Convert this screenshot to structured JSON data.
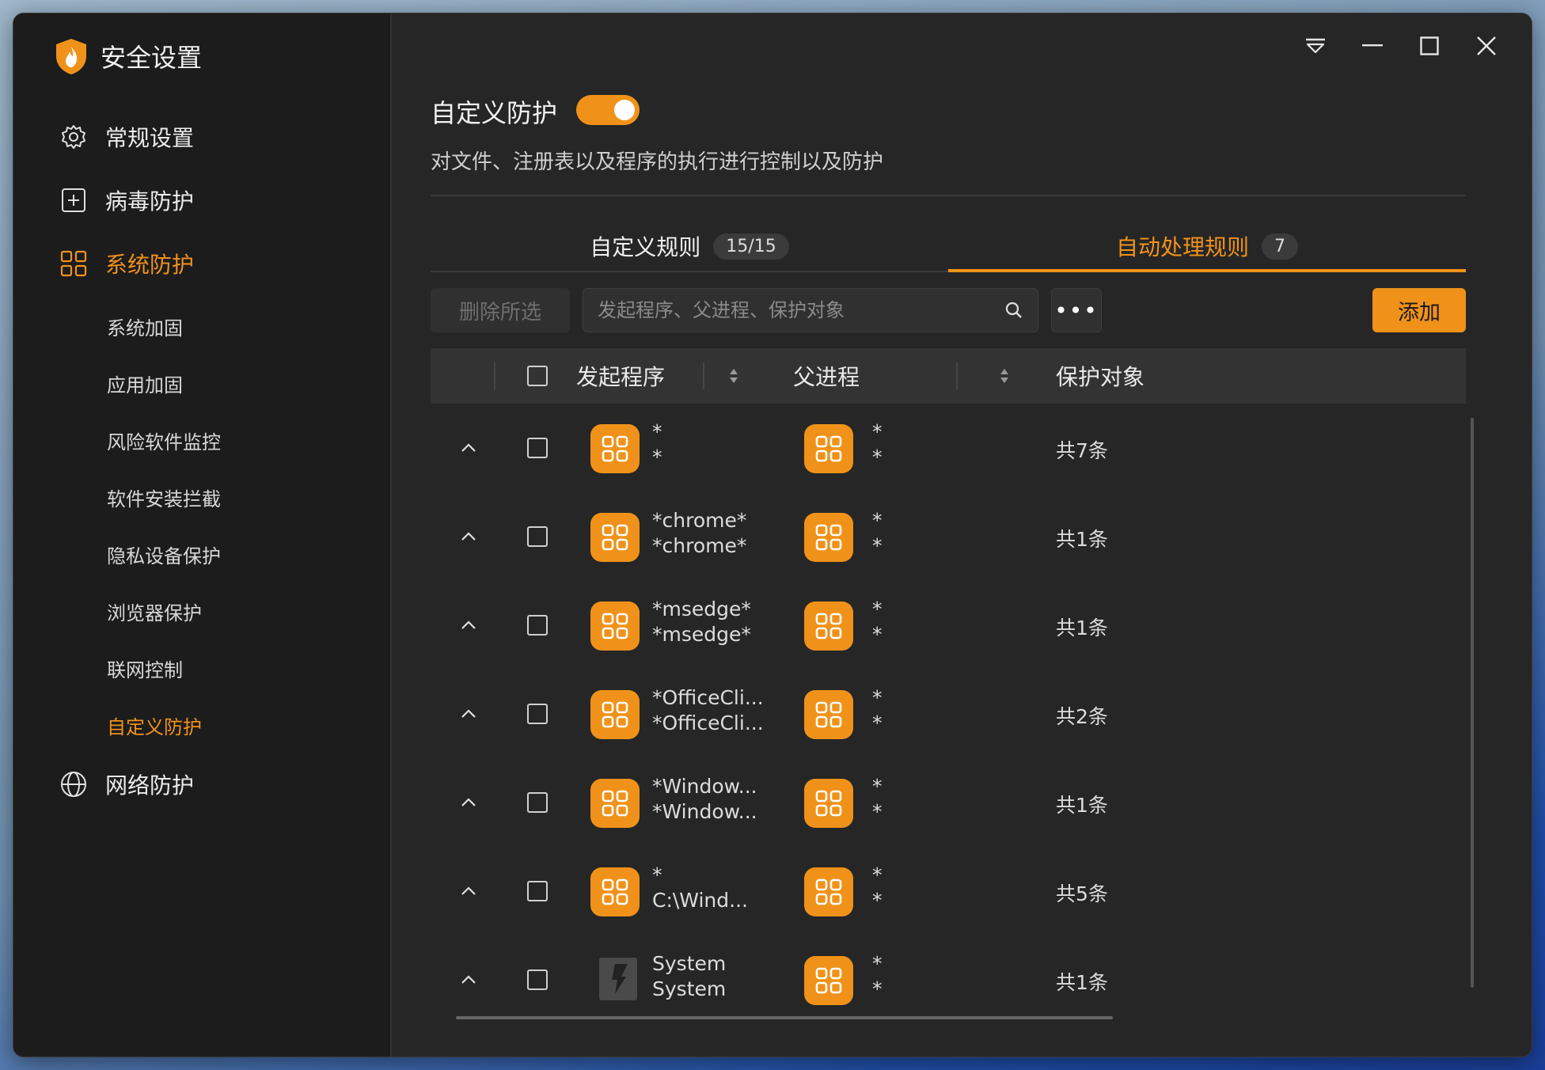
{
  "app": {
    "title": "安全设置"
  },
  "window_controls": [
    "menu",
    "minimize",
    "maximize",
    "close"
  ],
  "sidebar": {
    "main_items": [
      {
        "label": "常规设置",
        "icon": "gear-icon",
        "active": false
      },
      {
        "label": "病毒防护",
        "icon": "plus-box-icon",
        "active": false
      },
      {
        "label": "系统防护",
        "icon": "grid-icon",
        "active": true
      },
      {
        "label": "网络防护",
        "icon": "globe-icon",
        "active": false
      }
    ],
    "sub_items": [
      {
        "label": "系统加固",
        "active": false
      },
      {
        "label": "应用加固",
        "active": false
      },
      {
        "label": "风险软件监控",
        "active": false
      },
      {
        "label": "软件安装拦截",
        "active": false
      },
      {
        "label": "隐私设备保护",
        "active": false
      },
      {
        "label": "浏览器保护",
        "active": false
      },
      {
        "label": "联网控制",
        "active": false
      },
      {
        "label": "自定义防护",
        "active": true
      }
    ]
  },
  "header": {
    "title": "自定义防护",
    "toggle_on": true,
    "description": "对文件、注册表以及程序的执行进行控制以及防护"
  },
  "tabs": [
    {
      "label": "自定义规则",
      "badge": "15/15",
      "active": false
    },
    {
      "label": "自动处理规则",
      "badge": "7",
      "active": true
    }
  ],
  "toolbar": {
    "delete_label": "删除所选",
    "search_placeholder": "发起程序、父进程、保护对象",
    "more_label": "•••",
    "add_label": "添加"
  },
  "table": {
    "columns": [
      "发起程序",
      "父进程",
      "保护对象"
    ],
    "rows": [
      {
        "initiator_1": "*",
        "initiator_2": "*",
        "initiator_icon": "app-grid-icon",
        "parent_1": "*",
        "parent_2": "*",
        "count": "共7条"
      },
      {
        "initiator_1": "*chrome*",
        "initiator_2": "*chrome*",
        "initiator_icon": "app-grid-icon",
        "parent_1": "*",
        "parent_2": "*",
        "count": "共1条"
      },
      {
        "initiator_1": "*msedge*",
        "initiator_2": "*msedge*",
        "initiator_icon": "app-grid-icon",
        "parent_1": "*",
        "parent_2": "*",
        "count": "共1条"
      },
      {
        "initiator_1": "*OfficeCli...",
        "initiator_2": "*OfficeCli...",
        "initiator_icon": "app-grid-icon",
        "parent_1": "*",
        "parent_2": "*",
        "count": "共2条"
      },
      {
        "initiator_1": "*Window...",
        "initiator_2": "*Window...",
        "initiator_icon": "app-grid-icon",
        "parent_1": "*",
        "parent_2": "*",
        "count": "共1条"
      },
      {
        "initiator_1": "*",
        "initiator_2": "C:\\Wind...",
        "initiator_icon": "app-grid-icon",
        "parent_1": "*",
        "parent_2": "*",
        "count": "共5条"
      },
      {
        "initiator_1": "System",
        "initiator_2": "System",
        "initiator_icon": "system-icon",
        "parent_1": "*",
        "parent_2": "*",
        "count": "共1条"
      }
    ]
  },
  "colors": {
    "accent": "#f0921a",
    "window_bg": "#262626",
    "sidebar_bg": "#1c1c1c"
  }
}
